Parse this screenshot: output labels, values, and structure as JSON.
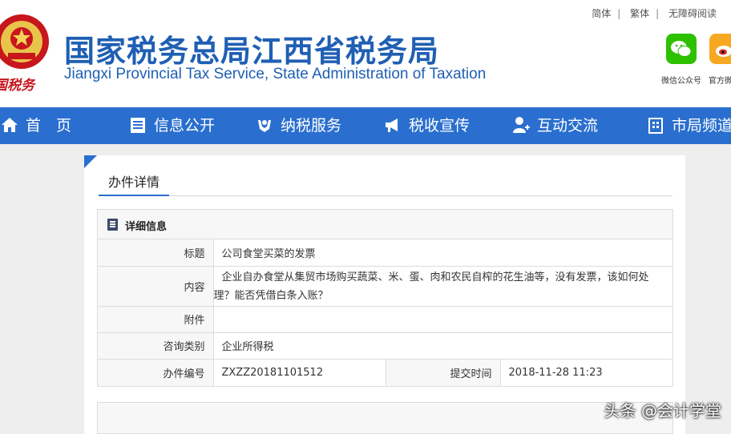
{
  "header": {
    "title_cn": "国家税务总局江西省税务局",
    "title_en": "Jiangxi Provincial Tax Service, State Administration of Taxation",
    "emblem_text": "中国税务",
    "toplinks": [
      "简体",
      "繁体",
      "无障碍阅读"
    ],
    "apps": [
      {
        "label": "微信公众号",
        "icon": "wechat-icon",
        "color": "#2dc100"
      },
      {
        "label": "官方微博",
        "icon": "weibo-icon",
        "color": "#f7a823"
      }
    ]
  },
  "nav": {
    "items": [
      {
        "label": "首　页",
        "icon": "home-icon"
      },
      {
        "label": "信息公开",
        "icon": "list-icon"
      },
      {
        "label": "纳税服务",
        "icon": "hands-icon"
      },
      {
        "label": "税收宣传",
        "icon": "megaphone-icon"
      },
      {
        "label": "互动交流",
        "icon": "user-icon"
      },
      {
        "label": "市局频道",
        "icon": "building-icon"
      }
    ],
    "color": "#2a6fcf"
  },
  "page": {
    "section_title": "办件详情",
    "detail_header": "详细信息",
    "rows": {
      "title_label": "标题",
      "title_value": "公司食堂买菜的发票",
      "content_label": "内容",
      "content_value": "企业自办食堂从集贸市场购买蔬菜、米、蛋、肉和农民自榨的花生油等，没有发票，该如何处理？能否凭借白条入账？",
      "attachment_label": "附件",
      "attachment_value": "",
      "category_label": "咨询类别",
      "category_value": "企业所得税",
      "number_label": "办件编号",
      "number_value": "ZXZZ20181101512",
      "time_label": "提交时间",
      "time_value": "2018-11-28 11:23"
    }
  },
  "watermark": "头条 @会计学堂"
}
